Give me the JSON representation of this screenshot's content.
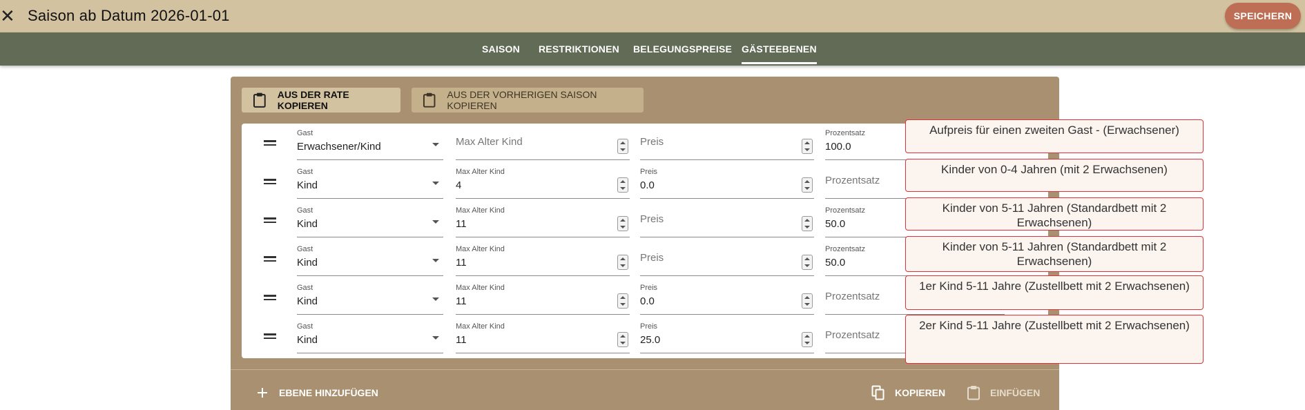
{
  "header": {
    "close_icon": "close-icon",
    "title": "Saison ab Datum 2026-01-01",
    "save_label": "SPEICHERN"
  },
  "tabs": [
    {
      "label": "SAISON",
      "active": false
    },
    {
      "label": "RESTRIKTIONEN",
      "active": false
    },
    {
      "label": "BELEGUNGSPREISE",
      "active": false
    },
    {
      "label": "GÄSTEEBENEN",
      "active": true
    }
  ],
  "toolbar": {
    "copy_from_rate": "AUS DER RATE KOPIEREN",
    "copy_from_previous": "AUS DER VORHERIGEN SAISON KOPIEREN"
  },
  "labels": {
    "gast": "Gast",
    "max_alter": "Max Alter Kind",
    "preis": "Preis",
    "prozentsatz": "Prozentsatz"
  },
  "rows": [
    {
      "gast": "Erwachsener/Kind",
      "max_alter": "",
      "preis": "",
      "prozentsatz": "100.0"
    },
    {
      "gast": "Kind",
      "max_alter": "4",
      "preis": "0.0",
      "prozentsatz": ""
    },
    {
      "gast": "Kind",
      "max_alter": "11",
      "preis": "",
      "prozentsatz": "50.0"
    },
    {
      "gast": "Kind",
      "max_alter": "11",
      "preis": "",
      "prozentsatz": "50.0"
    },
    {
      "gast": "Kind",
      "max_alter": "11",
      "preis": "0.0",
      "prozentsatz": ""
    },
    {
      "gast": "Kind",
      "max_alter": "11",
      "preis": "25.0",
      "prozentsatz": ""
    }
  ],
  "footer": {
    "add_level": "EBENE HINZUFÜGEN",
    "copy": "KOPIEREN",
    "paste": "EINFÜGEN"
  },
  "annotations": [
    "Aufpreis für einen zweiten Gast - (Erwachsener)",
    "Kinder von 0-4 Jahren (mit 2 Erwachsenen)",
    "Kinder von 5-11 Jahren (Standardbett mit 2 Erwachsenen)",
    "Kinder von 5-11 Jahren (Standardbett mit 2 Erwachsenen)",
    "1er Kind 5-11 Jahre (Zustellbett mit 2 Erwachsenen)",
    "2er Kind 5-11 Jahre (Zustellbett mit 2 Erwachsenen)"
  ],
  "colors": {
    "header_bg": "#d2c29f",
    "tabbar_bg": "#626b56",
    "panel_bg": "#a89070",
    "save_button": "#bd6e55",
    "annotation_border": "#e0303a"
  }
}
